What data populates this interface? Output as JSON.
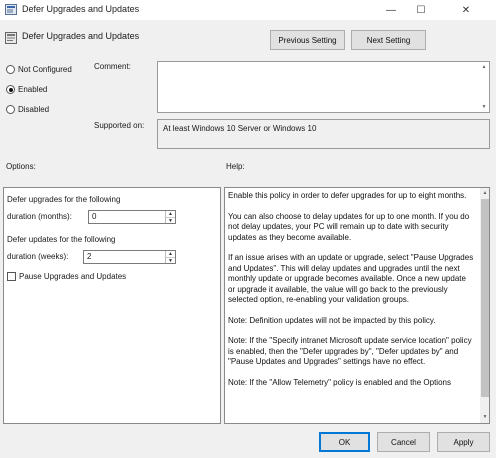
{
  "window": {
    "title": "Defer Upgrades and Updates",
    "minimize_glyph": "—",
    "maximize_glyph": "☐",
    "close_glyph": "✕"
  },
  "header": {
    "title": "Defer Upgrades and Updates",
    "previous_label": "Previous Setting",
    "next_label": "Next Setting"
  },
  "state": {
    "options": [
      "Not Configured",
      "Enabled",
      "Disabled"
    ],
    "selected": "Enabled"
  },
  "comment": {
    "label": "Comment:",
    "value": ""
  },
  "supported": {
    "label": "Supported on:",
    "value": "At least Windows 10 Server or Windows 10"
  },
  "options_section": {
    "title": "Options:",
    "upgrade_label_1": "Defer upgrades for the following",
    "upgrade_label_2": "duration (months):",
    "upgrade_value": "0",
    "update_label_1": "Defer updates for the following",
    "update_label_2": "duration (weeks):",
    "update_value": "2",
    "pause_label": "Pause Upgrades and Updates",
    "pause_checked": false
  },
  "help_section": {
    "title": "Help:",
    "paragraphs": [
      "Enable this policy in order to defer upgrades for up to eight months.",
      "You can also choose to delay updates for up to one month. If you do not delay updates, your PC will remain up to date with security updates as they become available.",
      "If an issue arises with an update or upgrade, select \"Pause Upgrades and Updates\". This will delay updates and upgrades until the next monthly update or upgrade becomes available. Once a new update or upgrade it available, the value will go back to the previously selected option, re-enabling your validation groups.",
      "Note: Definition updates will not be impacted by this policy.",
      "Note: If the \"Specify intranet Microsoft update service location\" policy is enabled, then the \"Defer upgrades by\", \"Defer updates by\" and \"Pause Updates and Upgrades\" settings have no effect.",
      "Note: If the \"Allow Telemetry\" policy is enabled and the Options"
    ]
  },
  "footer": {
    "ok_label": "OK",
    "cancel_label": "Cancel",
    "apply_label": "Apply"
  }
}
